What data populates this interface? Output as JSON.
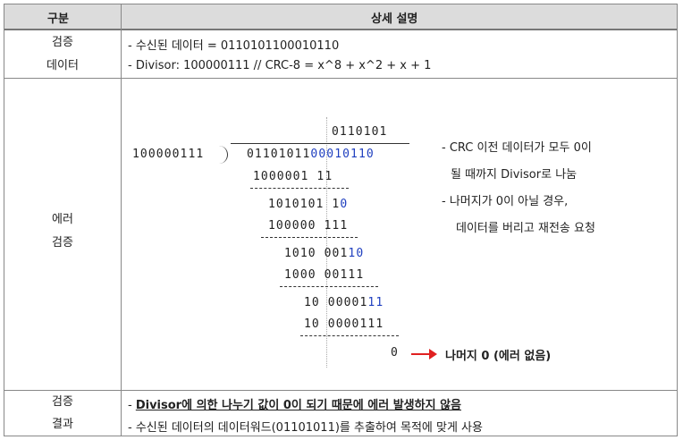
{
  "header": {
    "col1": "구분",
    "col2": "상세 설명"
  },
  "row1": {
    "label_line1": "검증",
    "label_line2": "데이터",
    "line1": "- 수신된 데이터 = 0110101100010110",
    "line2": "- Divisor: 100000111 // CRC-8 = x^8 + x^2 + x + 1"
  },
  "row2": {
    "label_line1": "에러",
    "label_line2": "검증",
    "quotient": "0110101",
    "divisor": "100000111",
    "dividend_black": "01101011",
    "dividend_blue": "00010110",
    "steps": [
      {
        "black": "1000001 11",
        "blue": ""
      },
      {
        "black": "1010101 1",
        "blue": "0"
      },
      {
        "black": "100000 111",
        "blue": ""
      },
      {
        "black": "1010 001",
        "blue": "10"
      },
      {
        "black": "1000 00111",
        "blue": ""
      },
      {
        "black": "10 00001",
        "blue": "11"
      },
      {
        "black": "10 0000111",
        "blue": ""
      }
    ],
    "remainder": "0",
    "result": "나머지 0 (에러 없음)",
    "notes": [
      "- CRC 이전 데이터가 모두 0이",
      "될 때까지 Divisor로 나눔",
      "- 나머지가 0이 아닐 경우,",
      "데이터를 버리고 재전송 요청"
    ]
  },
  "row3": {
    "label_line1": "검증",
    "label_line2": "결과",
    "line1_prefix": "- ",
    "line1_bold": "Divisor에 의한 나누기 값이 0이 되기 때문에 에러 발생하지 않음",
    "line2": "- 수신된 데이터의 데이터워드(01101011)를 추출하여 목적에 맞게 사용"
  },
  "colors": {
    "header_bg": "#dcdcdc",
    "blue_digits": "#1f3fbf",
    "arrow": "#e02020"
  },
  "icons": {
    "arrow": "right-arrow-icon"
  }
}
